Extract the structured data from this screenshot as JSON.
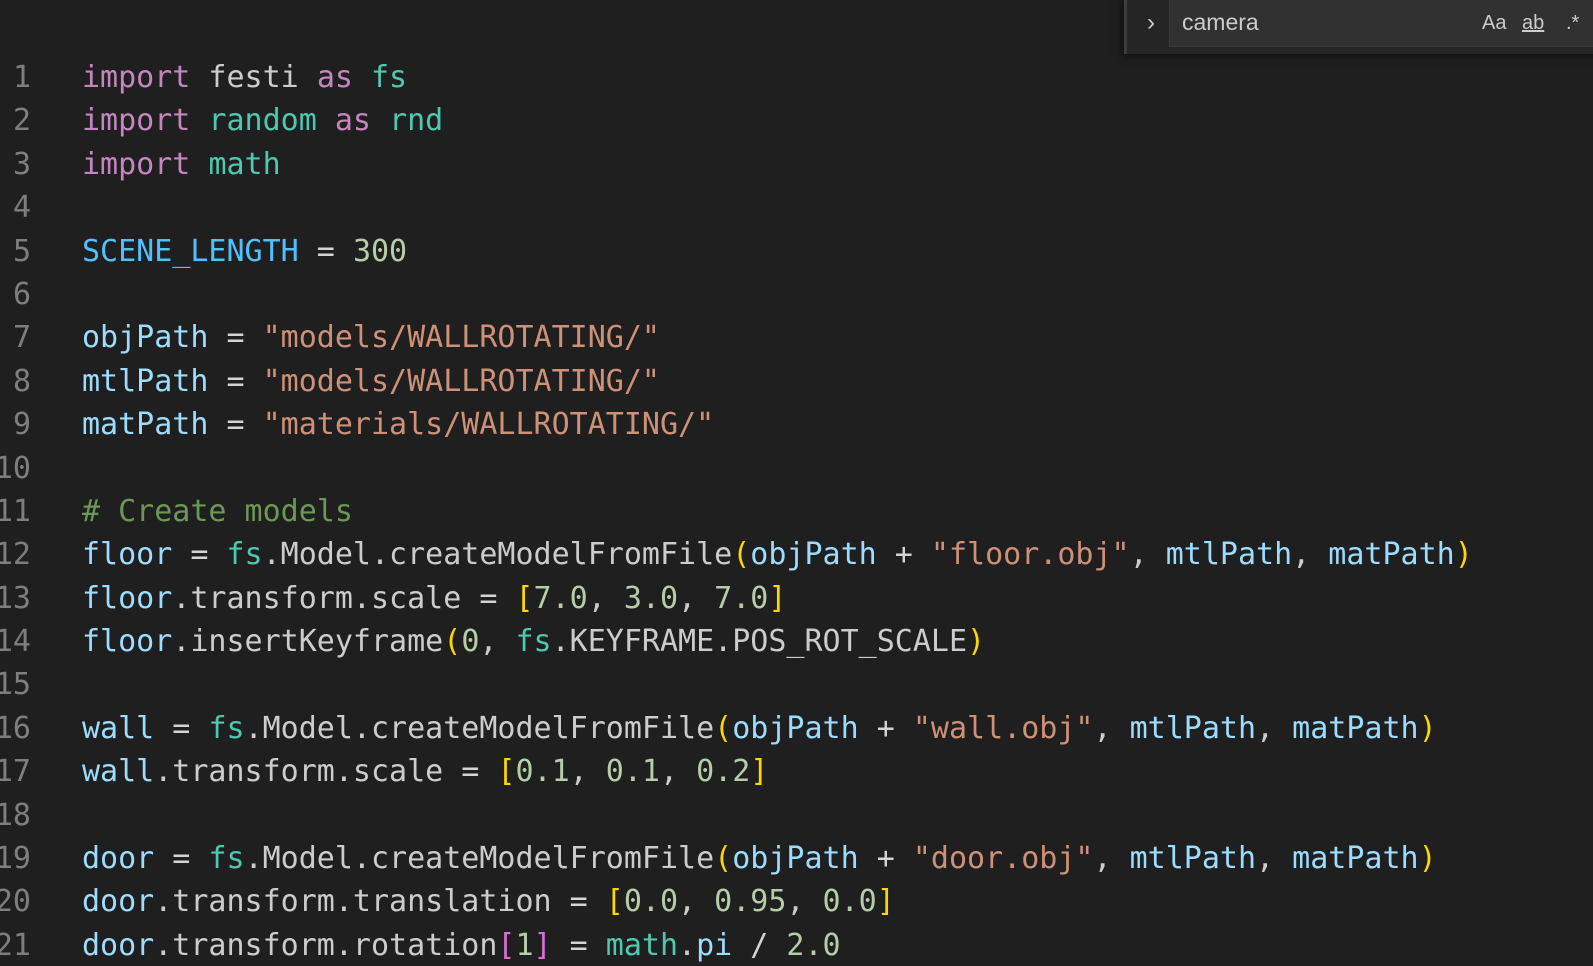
{
  "find": {
    "query": "camera",
    "toggle_glyph": "›",
    "match_case_label": "Aa",
    "match_word_label": "ab",
    "regex_label": ".*"
  },
  "editor": {
    "lines": [
      {
        "n": "1",
        "tokens": [
          [
            "kw",
            "import"
          ],
          [
            "plain",
            " festi "
          ],
          [
            "kw",
            "as"
          ],
          [
            "plain",
            " "
          ],
          [
            "ns",
            "fs"
          ]
        ]
      },
      {
        "n": "2",
        "tokens": [
          [
            "kw",
            "import"
          ],
          [
            "plain",
            " "
          ],
          [
            "ns",
            "random"
          ],
          [
            "plain",
            " "
          ],
          [
            "kw",
            "as"
          ],
          [
            "plain",
            " "
          ],
          [
            "ns",
            "rnd"
          ]
        ]
      },
      {
        "n": "3",
        "tokens": [
          [
            "kw",
            "import"
          ],
          [
            "plain",
            " "
          ],
          [
            "ns",
            "math"
          ]
        ]
      },
      {
        "n": "4",
        "tokens": []
      },
      {
        "n": "5",
        "tokens": [
          [
            "const",
            "SCENE_LENGTH"
          ],
          [
            "op",
            " = "
          ],
          [
            "num",
            "300"
          ]
        ]
      },
      {
        "n": "6",
        "tokens": []
      },
      {
        "n": "7",
        "tokens": [
          [
            "var",
            "objPath"
          ],
          [
            "op",
            " = "
          ],
          [
            "str",
            "\"models/WALLROTATING/\""
          ]
        ]
      },
      {
        "n": "8",
        "tokens": [
          [
            "var",
            "mtlPath"
          ],
          [
            "op",
            " = "
          ],
          [
            "str",
            "\"models/WALLROTATING/\""
          ]
        ]
      },
      {
        "n": "9",
        "tokens": [
          [
            "var",
            "matPath"
          ],
          [
            "op",
            " = "
          ],
          [
            "str",
            "\"materials/WALLROTATING/\""
          ]
        ]
      },
      {
        "n": "10",
        "tokens": []
      },
      {
        "n": "11",
        "tokens": [
          [
            "cmt",
            "# Create models"
          ]
        ]
      },
      {
        "n": "12",
        "tokens": [
          [
            "var",
            "floor"
          ],
          [
            "op",
            " = "
          ],
          [
            "ns",
            "fs"
          ],
          [
            "plain",
            ".Model.createModelFromFile"
          ],
          [
            "b1",
            "("
          ],
          [
            "var",
            "objPath"
          ],
          [
            "op",
            " + "
          ],
          [
            "str",
            "\"floor.obj\""
          ],
          [
            "plain",
            ", "
          ],
          [
            "var",
            "mtlPath"
          ],
          [
            "plain",
            ", "
          ],
          [
            "var",
            "matPath"
          ],
          [
            "b1",
            ")"
          ]
        ]
      },
      {
        "n": "13",
        "tokens": [
          [
            "var",
            "floor"
          ],
          [
            "plain",
            ".transform.scale"
          ],
          [
            "op",
            " = "
          ],
          [
            "b1",
            "["
          ],
          [
            "num",
            "7.0"
          ],
          [
            "plain",
            ", "
          ],
          [
            "num",
            "3.0"
          ],
          [
            "plain",
            ", "
          ],
          [
            "num",
            "7.0"
          ],
          [
            "b1",
            "]"
          ]
        ]
      },
      {
        "n": "14",
        "tokens": [
          [
            "var",
            "floor"
          ],
          [
            "plain",
            ".insertKeyframe"
          ],
          [
            "b1",
            "("
          ],
          [
            "num",
            "0"
          ],
          [
            "plain",
            ", "
          ],
          [
            "ns",
            "fs"
          ],
          [
            "plain",
            ".KEYFRAME.POS_ROT_SCALE"
          ],
          [
            "b1",
            ")"
          ]
        ]
      },
      {
        "n": "15",
        "tokens": []
      },
      {
        "n": "16",
        "tokens": [
          [
            "var",
            "wall"
          ],
          [
            "op",
            " = "
          ],
          [
            "ns",
            "fs"
          ],
          [
            "plain",
            ".Model.createModelFromFile"
          ],
          [
            "b1",
            "("
          ],
          [
            "var",
            "objPath"
          ],
          [
            "op",
            " + "
          ],
          [
            "str",
            "\"wall.obj\""
          ],
          [
            "plain",
            ", "
          ],
          [
            "var",
            "mtlPath"
          ],
          [
            "plain",
            ", "
          ],
          [
            "var",
            "matPath"
          ],
          [
            "b1",
            ")"
          ]
        ]
      },
      {
        "n": "17",
        "tokens": [
          [
            "var",
            "wall"
          ],
          [
            "plain",
            ".transform.scale"
          ],
          [
            "op",
            " = "
          ],
          [
            "b1",
            "["
          ],
          [
            "num",
            "0.1"
          ],
          [
            "plain",
            ", "
          ],
          [
            "num",
            "0.1"
          ],
          [
            "plain",
            ", "
          ],
          [
            "num",
            "0.2"
          ],
          [
            "b1",
            "]"
          ]
        ]
      },
      {
        "n": "18",
        "tokens": []
      },
      {
        "n": "19",
        "tokens": [
          [
            "var",
            "door"
          ],
          [
            "op",
            " = "
          ],
          [
            "ns",
            "fs"
          ],
          [
            "plain",
            ".Model.createModelFromFile"
          ],
          [
            "b1",
            "("
          ],
          [
            "var",
            "objPath"
          ],
          [
            "op",
            " + "
          ],
          [
            "str",
            "\"door.obj\""
          ],
          [
            "plain",
            ", "
          ],
          [
            "var",
            "mtlPath"
          ],
          [
            "plain",
            ", "
          ],
          [
            "var",
            "matPath"
          ],
          [
            "b1",
            ")"
          ]
        ]
      },
      {
        "n": "20",
        "tokens": [
          [
            "var",
            "door"
          ],
          [
            "plain",
            ".transform.translation"
          ],
          [
            "op",
            " = "
          ],
          [
            "b1",
            "["
          ],
          [
            "num",
            "0.0"
          ],
          [
            "plain",
            ", "
          ],
          [
            "num",
            "0.95"
          ],
          [
            "plain",
            ", "
          ],
          [
            "num",
            "0.0"
          ],
          [
            "b1",
            "]"
          ]
        ]
      },
      {
        "n": "21",
        "tokens": [
          [
            "var",
            "door"
          ],
          [
            "plain",
            ".transform.rotation"
          ],
          [
            "b2",
            "["
          ],
          [
            "num",
            "1"
          ],
          [
            "b2",
            "]"
          ],
          [
            "op",
            " = "
          ],
          [
            "ns",
            "math"
          ],
          [
            "plain",
            "."
          ],
          [
            "var",
            "pi"
          ],
          [
            "op",
            " / "
          ],
          [
            "num",
            "2.0"
          ]
        ]
      }
    ]
  },
  "colors": {
    "background": "#1f1f1f",
    "keyword": "#c586c0",
    "namespace": "#4ec9b0",
    "variable": "#9cdcfe",
    "constant": "#4fc1ff",
    "number": "#b5cea8",
    "string": "#ce9178",
    "comment": "#6a9955",
    "bracket_level1": "#ffd700",
    "bracket_level2": "#da70d6",
    "line_number": "#7e7e7e"
  }
}
